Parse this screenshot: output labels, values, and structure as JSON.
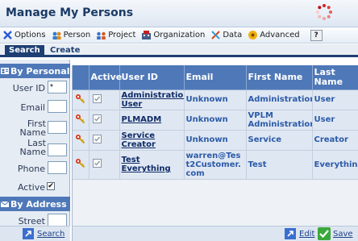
{
  "title": "Manage My Persons",
  "menu": [
    {
      "label": "Options",
      "icon": "options-icon"
    },
    {
      "label": "Person",
      "icon": "person-icon"
    },
    {
      "label": "Project",
      "icon": "project-icon"
    },
    {
      "label": "Organization",
      "icon": "organization-icon"
    },
    {
      "label": "Data",
      "icon": "data-icon"
    },
    {
      "label": "Advanced",
      "icon": "advanced-icon"
    }
  ],
  "help_label": "?",
  "tabs": {
    "search": "Search",
    "create": "Create"
  },
  "left": {
    "by_personal": "By Personal",
    "user_id_label": "User ID",
    "user_id_value": "*",
    "email_label": "Email",
    "first_name_label": "First Name",
    "last_name_label": "Last Name",
    "phone_label": "Phone",
    "active_label": "Active",
    "active_checked": true,
    "by_address": "By Address",
    "street_label": "Street",
    "search_button": "Search"
  },
  "table": {
    "columns": [
      "Active",
      "User ID",
      "Email",
      "First Name",
      "Last Name"
    ],
    "rows": [
      {
        "user_id": "Administration User",
        "email": "Unknown",
        "first_name": "Administration",
        "last_name": "User"
      },
      {
        "user_id": "PLMADM",
        "email": "Unknown",
        "first_name": "VPLM Administration",
        "last_name": "User"
      },
      {
        "user_id": "Service Creator",
        "email": "Unknown",
        "first_name": "Service",
        "last_name": "Creator"
      },
      {
        "user_id": "Test Everything",
        "email": "warren@Test2Customer.com",
        "first_name": "Test",
        "last_name": "Everything"
      }
    ]
  },
  "footer": {
    "edit": "Edit",
    "save": "Save"
  },
  "colors": {
    "header_blue": "#4e78b8",
    "tab_navy": "#1e3f73",
    "link_blue": "#2b5aa8",
    "row_bg": "#dfe7f2"
  }
}
